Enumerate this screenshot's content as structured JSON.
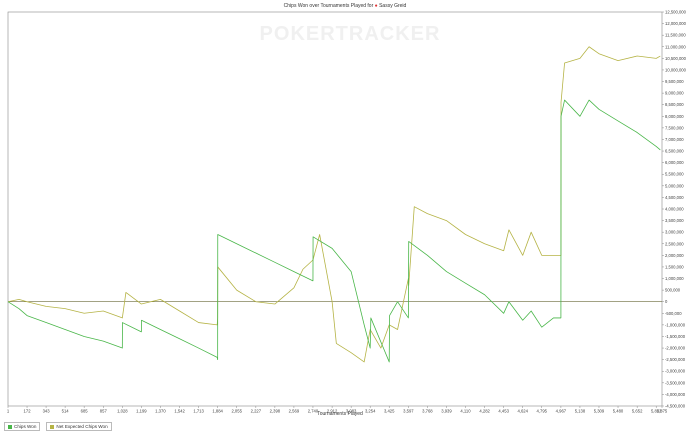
{
  "chart_data": {
    "type": "line",
    "title_prefix": "Chips Won over Tournaments Played for",
    "player": "Sassy Greid",
    "watermark": "POKERTRACKER",
    "xlabel": "Tournaments Played",
    "ylabel": "",
    "x_ticks": [
      "1",
      "172",
      "343",
      "514",
      "685",
      "857",
      "1,028",
      "1,199",
      "1,370",
      "1,542",
      "1,713",
      "1,884",
      "2,055",
      "2,227",
      "2,398",
      "2,569",
      "2,740",
      "2,912",
      "3,083",
      "3,254",
      "3,425",
      "3,597",
      "3,768",
      "3,939",
      "4,110",
      "4,282",
      "4,453",
      "4,624",
      "4,795",
      "4,967",
      "5,138",
      "5,309",
      "5,480",
      "5,652",
      "5,823",
      "5,875"
    ],
    "xlim": [
      1,
      5875
    ],
    "ylim": [
      -4500000,
      12500000
    ],
    "y_ticks": [
      "12,500,000",
      "12,000,000",
      "11,500,000",
      "11,000,000",
      "10,500,000",
      "10,000,000",
      "9,500,000",
      "9,000,000",
      "8,500,000",
      "8,000,000",
      "7,500,000",
      "7,000,000",
      "6,500,000",
      "6,000,000",
      "5,500,000",
      "5,000,000",
      "4,500,000",
      "4,000,000",
      "3,500,000",
      "3,000,000",
      "2,500,000",
      "2,000,000",
      "1,500,000",
      "1,000,000",
      "500,000",
      "0",
      "-500,000",
      "-1,000,000",
      "-1,500,000",
      "-2,000,000",
      "-2,500,000",
      "-3,000,000",
      "-3,500,000",
      "-4,000,000",
      "-4,500,000"
    ],
    "series": [
      {
        "name": "Chips Won",
        "color": "#49b649",
        "x": [
          1,
          100,
          172,
          343,
          514,
          685,
          857,
          1028,
          1029,
          1199,
          1200,
          1370,
          1542,
          1713,
          1880,
          1884,
          1885,
          2055,
          2227,
          2398,
          2569,
          2740,
          2741,
          2912,
          3083,
          3200,
          3254,
          3260,
          3425,
          3428,
          3500,
          3597,
          3600,
          3768,
          3939,
          4110,
          4282,
          4453,
          4500,
          4624,
          4700,
          4795,
          4900,
          4967,
          4968,
          5000,
          5138,
          5220,
          5309,
          5480,
          5652,
          5823,
          5860
        ],
        "y": [
          0,
          -300000,
          -600000,
          -900000,
          -1200000,
          -1500000,
          -1700000,
          -2000000,
          -900000,
          -1300000,
          -800000,
          -1200000,
          -1600000,
          -2000000,
          -2400000,
          -2500000,
          2900000,
          2500000,
          2100000,
          1700000,
          1300000,
          900000,
          2800000,
          2300000,
          1300000,
          -1000000,
          -2000000,
          -700000,
          -2600000,
          -600000,
          0,
          -700000,
          2600000,
          2000000,
          1300000,
          800000,
          300000,
          -500000,
          0,
          -800000,
          -400000,
          -1100000,
          -700000,
          -700000,
          8000000,
          8700000,
          8000000,
          8700000,
          8300000,
          7800000,
          7300000,
          6700000,
          6550000
        ]
      },
      {
        "name": "Net Expected Chips Won",
        "color": "#b5b345",
        "x": [
          1,
          100,
          172,
          343,
          514,
          685,
          857,
          1028,
          1060,
          1199,
          1370,
          1542,
          1713,
          1880,
          1884,
          1885,
          2055,
          2227,
          2398,
          2569,
          2650,
          2740,
          2800,
          2912,
          2950,
          3083,
          3200,
          3254,
          3350,
          3425,
          3500,
          3597,
          3600,
          3650,
          3768,
          3939,
          4110,
          4282,
          4453,
          4500,
          4624,
          4700,
          4795,
          4967,
          4968,
          5000,
          5138,
          5220,
          5309,
          5480,
          5652,
          5823,
          5860
        ],
        "y": [
          0,
          100000,
          0,
          -200000,
          -300000,
          -500000,
          -400000,
          -700000,
          400000,
          -100000,
          100000,
          -400000,
          -900000,
          -1000000,
          -700000,
          1500000,
          500000,
          0,
          -100000,
          600000,
          1400000,
          1800000,
          2900000,
          0,
          -1800000,
          -2200000,
          -2600000,
          -1200000,
          -2000000,
          -1000000,
          -1200000,
          1000000,
          700000,
          4100000,
          3800000,
          3500000,
          2900000,
          2500000,
          2200000,
          3100000,
          2000000,
          3000000,
          2000000,
          2000000,
          8600000,
          10300000,
          10500000,
          11000000,
          10700000,
          10400000,
          10600000,
          10500000,
          10600000
        ]
      }
    ],
    "grid": false,
    "legend": "bottom-left"
  }
}
